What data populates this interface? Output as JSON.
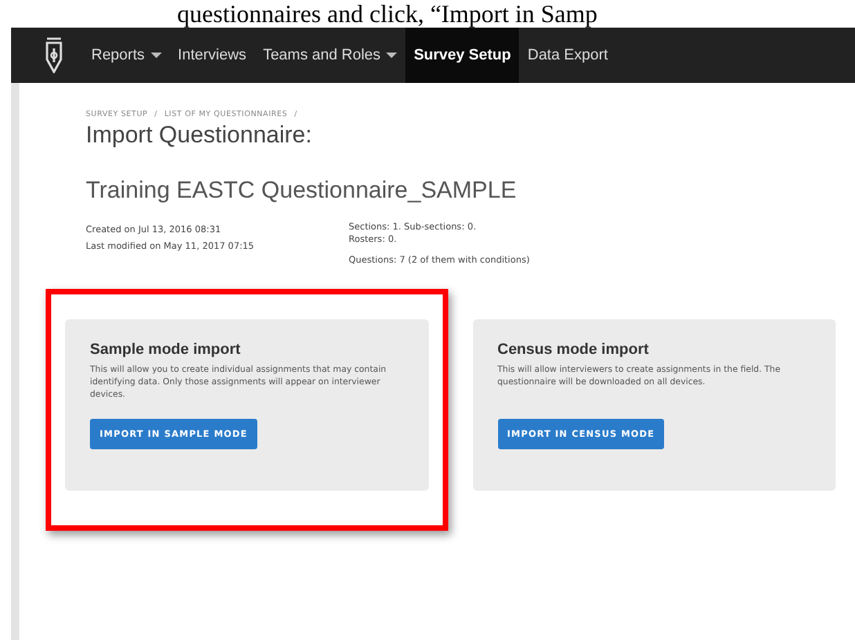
{
  "document_text": "questionnaires and click, “Import in Samp",
  "nav": [
    {
      "label": "Reports",
      "dropdown": true,
      "selected": false
    },
    {
      "label": "Interviews",
      "dropdown": false,
      "selected": false
    },
    {
      "label": "Teams and Roles",
      "dropdown": true,
      "selected": false
    },
    {
      "label": "Survey Setup",
      "dropdown": false,
      "selected": true
    },
    {
      "label": "Data Export",
      "dropdown": false,
      "selected": false
    }
  ],
  "breadcrumb": [
    {
      "label": "SURVEY SETUP",
      "separator": "/"
    },
    {
      "label": "LIST OF MY QUESTIONNAIRES",
      "separator": "/"
    }
  ],
  "page_title": "Import Questionnaire:",
  "questionnaire_title": "Training EASTC Questionnaire_SAMPLE",
  "meta_left": [
    "Created on Jul 13, 2016 08:31",
    "Last modified on May 11, 2017 07:15"
  ],
  "meta_right": [
    "Sections: 1.  Sub-sections: 0.",
    "Rosters: 0.",
    "Questions: 7 (2 of them with conditions)"
  ],
  "cards": [
    {
      "title": "Sample mode import",
      "text": "This will allow you to create individual assignments that may contain identifying data. Only those assignments will appear on interviewer devices.",
      "button": "IMPORT IN SAMPLE MODE",
      "highlighted": true
    },
    {
      "title": "Census mode import",
      "text": "This will allow interviewers to create assignments in the field. The questionnaire will be downloaded on all devices.",
      "button": "IMPORT IN CENSUS MODE",
      "highlighted": false
    }
  ]
}
